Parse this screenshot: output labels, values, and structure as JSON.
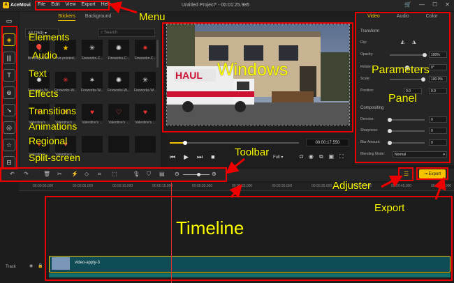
{
  "app": {
    "name": "AceMovi",
    "project_title": "Untitled Project* - 00:01:25.985"
  },
  "menu": [
    "File",
    "Edit",
    "View",
    "Export",
    "Help"
  ],
  "media": {
    "tabs": [
      "Stickers",
      "Background"
    ],
    "dropdown": "All (263)",
    "search_placeholder": "Search",
    "items": [
      {
        "label": "Birthday-Ball...",
        "icon": "🎈",
        "color": "#e85"
      },
      {
        "label": "Five-pointed...",
        "icon": "★",
        "color": "#f5c400"
      },
      {
        "label": "Fireworks-C...",
        "icon": "✳",
        "color": "#ddd"
      },
      {
        "label": "Fireworks-C...",
        "icon": "✺",
        "color": "#ddd"
      },
      {
        "label": "Fireworks-C...",
        "icon": "✷",
        "color": "#e33"
      },
      {
        "label": "Fireworks-W...",
        "icon": "✹",
        "color": "#ddd"
      },
      {
        "label": "Fireworks-W...",
        "icon": "✳",
        "color": "#e33"
      },
      {
        "label": "Fireworks-W...",
        "icon": "✶",
        "color": "#ddd"
      },
      {
        "label": "Fireworks-W...",
        "icon": "✺",
        "color": "#ddd"
      },
      {
        "label": "Fireworks-W...",
        "icon": "✳",
        "color": "#ddd"
      },
      {
        "label": "Valentine's ...",
        "icon": "♥",
        "color": "#e33"
      },
      {
        "label": "Valentine's ...",
        "icon": "✉",
        "color": "#e77"
      },
      {
        "label": "Valentine's ...",
        "icon": "♥",
        "color": "#e33"
      },
      {
        "label": "Valentine's ...",
        "icon": "♡",
        "color": "#e55"
      },
      {
        "label": "Valentine's ...",
        "icon": "♥",
        "color": "#e33"
      },
      {
        "label": "Valentine's ...",
        "icon": "♥",
        "color": "#e33"
      },
      {
        "label": "Valentine's ...",
        "icon": "♥",
        "color": "#e55"
      },
      {
        "label": "",
        "icon": "",
        "color": "#ddd"
      },
      {
        "label": "",
        "icon": "",
        "color": "#ddd"
      },
      {
        "label": "",
        "icon": "",
        "color": "#ddd"
      }
    ]
  },
  "preview": {
    "timecode": "00:00:17.550",
    "zoom": "Full",
    "progress": 0.12
  },
  "properties": {
    "tabs": [
      "Video",
      "Audio",
      "Color"
    ],
    "transform_title": "Transform",
    "flip_label": "Flip:",
    "opacity": {
      "label": "Opacity:",
      "value": "100%",
      "level": 1.0
    },
    "rotate": {
      "label": "Rotate:",
      "value": "0°",
      "level": 0.5
    },
    "scale": {
      "label": "Scale:",
      "value": "100.0%",
      "level": 0.95
    },
    "position": {
      "label": "Position:",
      "x": "0.0",
      "y": "0.0"
    },
    "compositing_title": "Compositing",
    "denoise": {
      "label": "Denoise:",
      "value": "0"
    },
    "sharpness": {
      "label": "Sharpness:",
      "value": "0"
    },
    "blur": {
      "label": "Blur Amount:",
      "value": "0"
    },
    "blend": {
      "label": "Blending Mode:",
      "value": "Normal"
    }
  },
  "export_label": "Export",
  "ruler_ticks": [
    "00:00:00.000",
    "00:00:05.000",
    "00:00:10.000",
    "00:00:15.000",
    "00:00:20.000",
    "00:00:25.000",
    "00:00:30.000",
    "00:00:35.000",
    "00:00:40.000",
    "00:00:45.000",
    "00:00:50.000"
  ],
  "track": {
    "label": "Track",
    "clip_name": "video-apply-3"
  },
  "annotations": {
    "menu": "Menu",
    "elements": "Elements",
    "audio": "Audio",
    "text": "Text",
    "effects": "Effects",
    "transitions": "Transitions",
    "animations": "Animations",
    "regional": "Regional",
    "split_screen": "Split-screen",
    "windows": "Windows",
    "parameters": "Parameters",
    "panel": "Panel",
    "toolbar": "Toolbar",
    "adjuster": "Adjuster",
    "export": "Export",
    "timeline": "Timeline"
  },
  "colors": {
    "accent": "#f5c400",
    "annotation": "#ffff00",
    "highlight_box": "#e00000",
    "clip": "#0f4c55"
  }
}
